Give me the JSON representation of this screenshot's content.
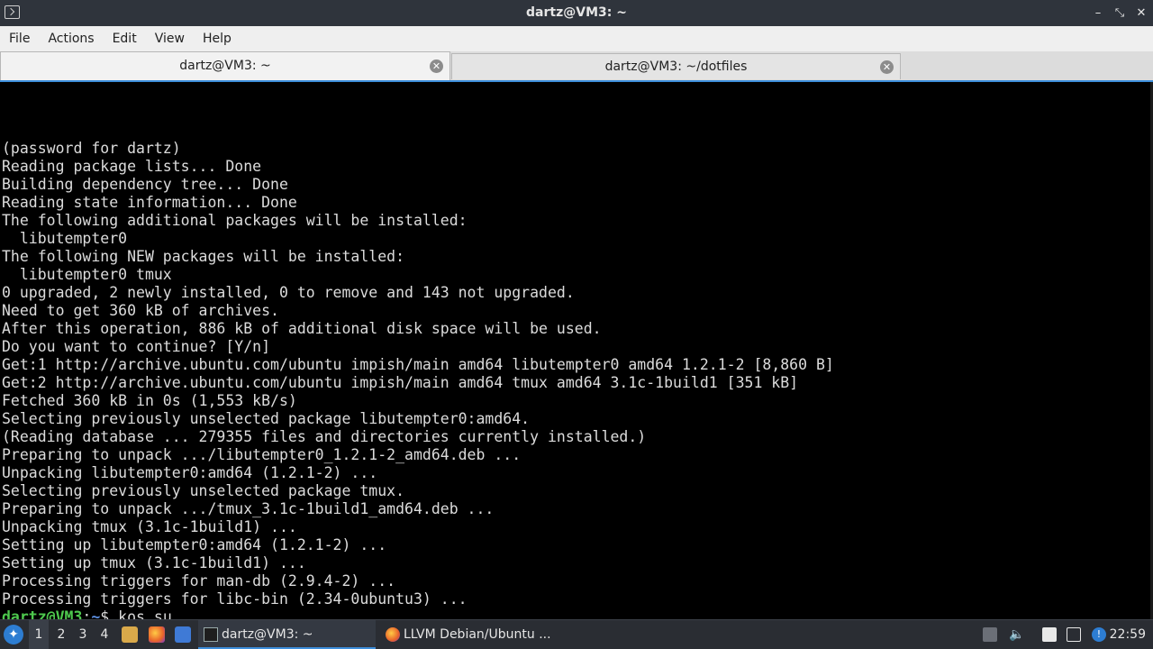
{
  "window": {
    "title": "dartz@VM3: ~",
    "minimize_glyph": "–",
    "maximize_glyph": "⤡",
    "close_glyph": "✕"
  },
  "menu": [
    "File",
    "Actions",
    "Edit",
    "View",
    "Help"
  ],
  "tabs": [
    {
      "label": "dartz@VM3: ~",
      "active": true
    },
    {
      "label": "dartz@VM3: ~/dotfiles",
      "active": false
    }
  ],
  "terminal": {
    "lines": [
      "(password for dartz)",
      "Reading package lists... Done",
      "Building dependency tree... Done",
      "Reading state information... Done",
      "The following additional packages will be installed:",
      "  libutempter0",
      "The following NEW packages will be installed:",
      "  libutempter0 tmux",
      "0 upgraded, 2 newly installed, 0 to remove and 143 not upgraded.",
      "Need to get 360 kB of archives.",
      "After this operation, 886 kB of additional disk space will be used.",
      "Do you want to continue? [Y/n]",
      "Get:1 http://archive.ubuntu.com/ubuntu impish/main amd64 libutempter0 amd64 1.2.1-2 [8,860 B]",
      "Get:2 http://archive.ubuntu.com/ubuntu impish/main amd64 tmux amd64 3.1c-1build1 [351 kB]",
      "Fetched 360 kB in 0s (1,553 kB/s)",
      "Selecting previously unselected package libutempter0:amd64.",
      "(Reading database ... 279355 files and directories currently installed.)",
      "Preparing to unpack .../libutempter0_1.2.1-2_amd64.deb ...",
      "Unpacking libutempter0:amd64 (1.2.1-2) ...",
      "Selecting previously unselected package tmux.",
      "Preparing to unpack .../tmux_3.1c-1build1_amd64.deb ...",
      "Unpacking tmux (3.1c-1build1) ...",
      "Setting up libutempter0:amd64 (1.2.1-2) ...",
      "Setting up tmux (3.1c-1build1) ...",
      "Processing triggers for man-db (2.9.4-2) ...",
      "Processing triggers for libc-bin (2.34-0ubuntu3) ..."
    ],
    "prompt": {
      "user_host": "dartz@VM3",
      "sep": ":",
      "path": "~",
      "symbol": "$ ",
      "command": "kos su"
    },
    "last_line": "(password for dartz) "
  },
  "taskbar": {
    "workspaces": [
      "1",
      "2",
      "3",
      "4"
    ],
    "active_workspace": "1",
    "tasks": [
      {
        "label": "dartz@VM3: ~",
        "icon": "terminal-icon",
        "active": true
      },
      {
        "label": "LLVM Debian/Ubuntu ...",
        "icon": "firefox-icon",
        "active": false
      }
    ],
    "clock": "22:59"
  },
  "colors": {
    "accent": "#3d8edb",
    "prompt_user": "#4ec94e",
    "prompt_path": "#5c8fe0"
  }
}
